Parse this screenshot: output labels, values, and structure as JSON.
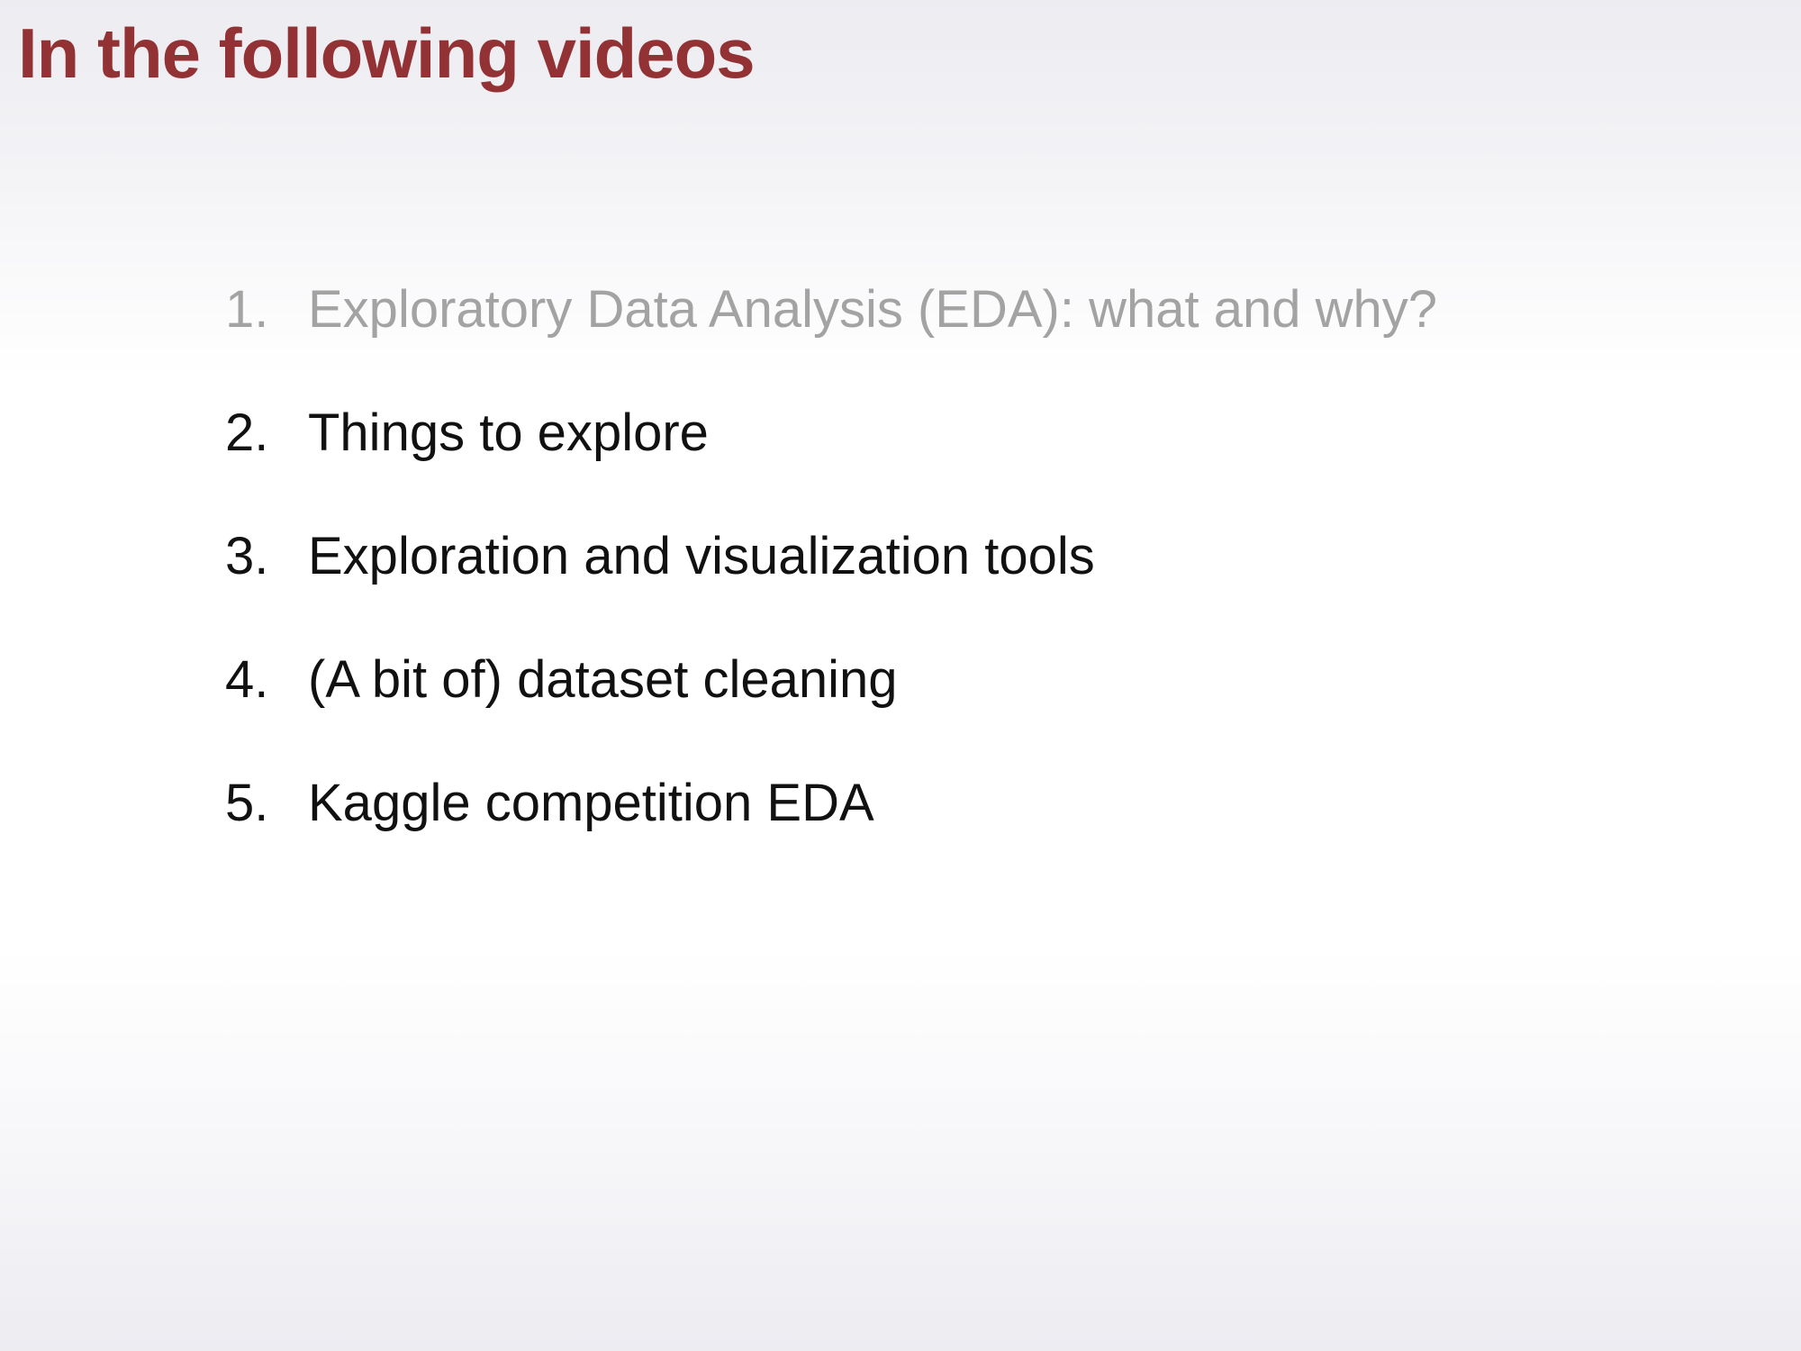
{
  "slide": {
    "title": "In the following videos",
    "title_color": "#923234",
    "items": [
      {
        "number": "1.",
        "text": "Exploratory Data Analysis (EDA): what and why?",
        "state": "done",
        "color": "#a3a3a3"
      },
      {
        "number": "2.",
        "text": "Things to explore",
        "state": "upcoming",
        "color": "#111111"
      },
      {
        "number": "3.",
        "text": "Exploration and visualization tools",
        "state": "upcoming",
        "color": "#111111"
      },
      {
        "number": "4.",
        "text": "(A bit of) dataset cleaning",
        "state": "upcoming",
        "color": "#111111"
      },
      {
        "number": "5.",
        "text": "Kaggle competition EDA",
        "state": "upcoming",
        "color": "#111111"
      }
    ]
  }
}
